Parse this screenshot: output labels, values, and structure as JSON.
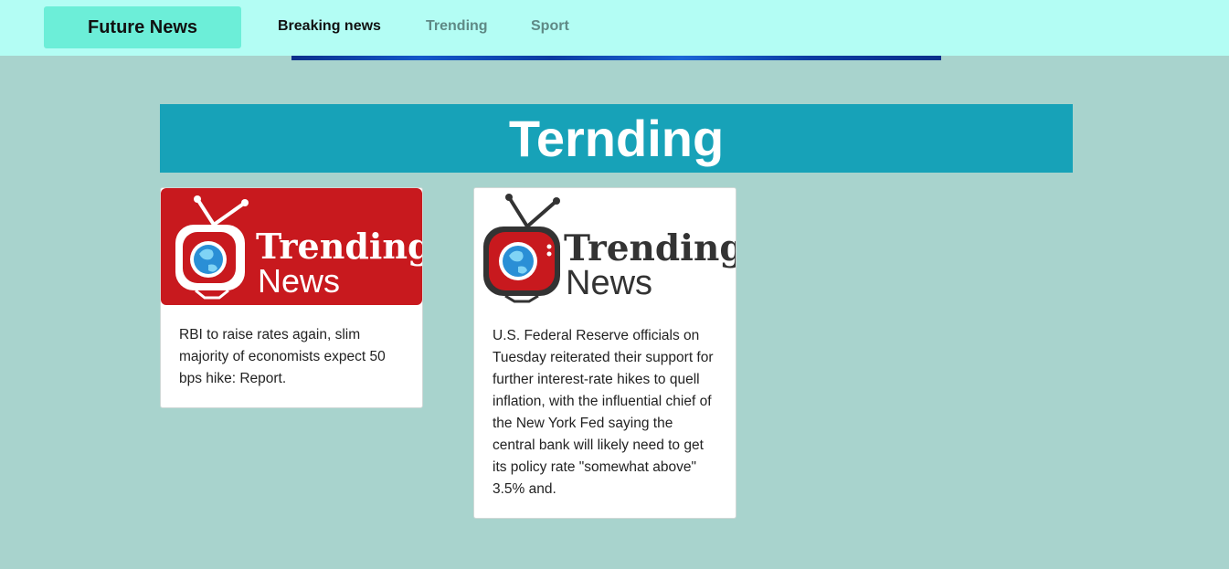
{
  "nav": {
    "brand": "Future News",
    "links": [
      "Breaking news",
      "Trending",
      "Sport"
    ]
  },
  "section": {
    "title": "Ternding"
  },
  "cards": [
    {
      "logo_line1": "Trending",
      "logo_line2": "News",
      "logo_style": "red-background",
      "text": "RBI to raise rates again, slim majority of economists expect 50 bps hike: Report."
    },
    {
      "logo_line1": "Trending",
      "logo_line2": "News",
      "logo_style": "white-background",
      "text": "U.S. Federal Reserve officials on Tuesday reiterated their support for further interest-rate hikes to quell inflation, with the influential chief of the New York Fed saying the central bank will likely need to get its policy rate \"somewhat above\" 3.5% and."
    }
  ],
  "colors": {
    "page_bg": "#a8d3cd",
    "nav_bg": "#b3fdf4",
    "brand_bg": "#6ceed8",
    "section_bg": "#17a2b8",
    "logo_red": "#c8191e"
  }
}
